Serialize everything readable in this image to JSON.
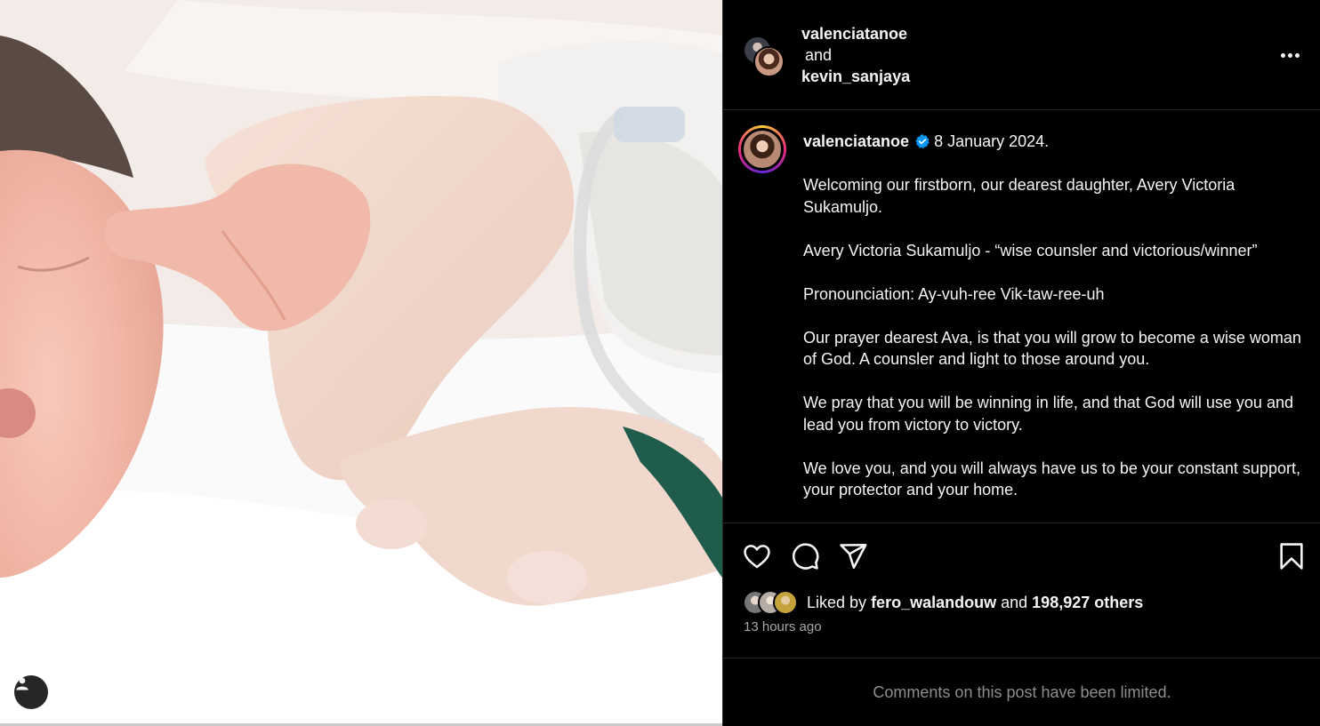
{
  "header": {
    "user_one": "valenciatanoe",
    "conjunction": "and",
    "user_two": "kevin_sanjaya",
    "more_icon": "more-horizontal-icon"
  },
  "photo": {
    "user_tag_icon": "person-icon"
  },
  "caption": {
    "username": "valenciatanoe",
    "verified_icon": "verified-badge-icon",
    "date": "8 January 2024.",
    "paragraphs": [
      "Welcoming our firstborn, our dearest daughter, Avery Victoria Sukamuljo.",
      "Avery Victoria Sukamuljo - “wise counsler and victorious/winner”",
      "Pronounciation: Ay-vuh-ree Vik-taw-ree-uh",
      "Our prayer dearest Ava, is that you will grow to become a wise woman of God. A counsler and light to those around you.",
      "We pray that you will be winning in life, and that God will use you and lead you from victory to victory.",
      "We love you, and you will always have us to be your constant support, your protector and your home."
    ]
  },
  "actions": {
    "like_icon": "heart-icon",
    "comment_icon": "comment-icon",
    "share_icon": "send-icon",
    "save_icon": "bookmark-icon"
  },
  "likes": {
    "prefix": "Liked by",
    "first_liker": "fero_walandouw",
    "middle": "and",
    "others": "198,927 others"
  },
  "timestamp": "13 hours ago",
  "comments_notice": "Comments on this post have been limited.",
  "colors": {
    "background": "#000000",
    "text": "#f5f5f5",
    "muted": "#a8a8a8",
    "verified": "#0095f6",
    "divider": "#262626"
  }
}
